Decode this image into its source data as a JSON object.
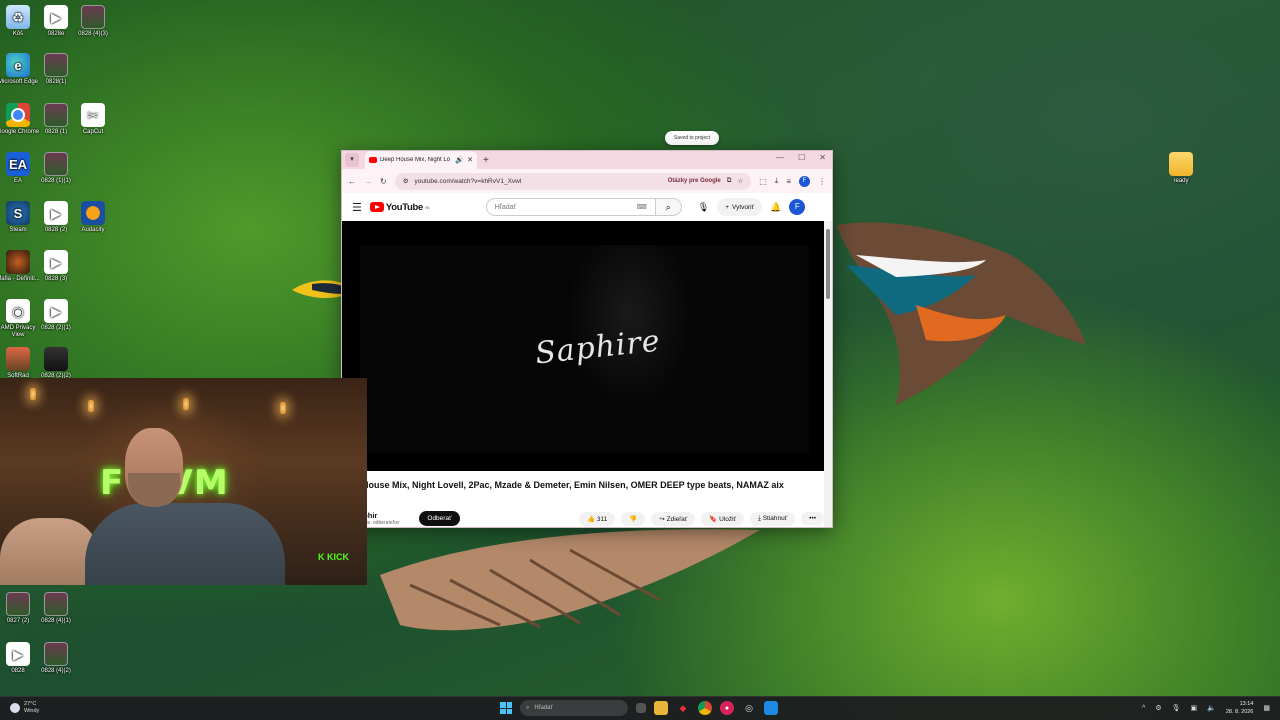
{
  "desktop": {
    "icons_left": [
      {
        "label": "Kôš",
        "glyph": "♻",
        "kind": "bin"
      },
      {
        "label": "0828e",
        "glyph": "▶",
        "kind": "play"
      },
      {
        "label": "0828 (4)(3)",
        "glyph": "",
        "kind": "thumb"
      },
      {
        "label": "Microsoft Edge",
        "glyph": "e",
        "kind": "edge"
      },
      {
        "label": "0828(1)",
        "glyph": "",
        "kind": "thumb"
      },
      {
        "label": "Google Chrome",
        "glyph": "",
        "kind": "chrome"
      },
      {
        "label": "0828 (1)",
        "glyph": "",
        "kind": "thumb"
      },
      {
        "label": "CapCut",
        "glyph": "✂",
        "kind": "capcut"
      },
      {
        "label": "EA",
        "glyph": "EA",
        "kind": "ea"
      },
      {
        "label": "0828 (1)(1)",
        "glyph": "",
        "kind": "thumb"
      },
      {
        "label": "Steam",
        "glyph": "S",
        "kind": "steam"
      },
      {
        "label": "0828 (2)",
        "glyph": "▶",
        "kind": "play"
      },
      {
        "label": "Audacity",
        "glyph": "",
        "kind": "aud"
      },
      {
        "label": "Mafia - Definiti...",
        "glyph": "",
        "kind": "mafia"
      },
      {
        "label": "0828 (3)",
        "glyph": "▶",
        "kind": "play"
      },
      {
        "label": "AMD Privacy View",
        "glyph": "◉",
        "kind": "amd"
      },
      {
        "label": "0828 (2)(1)",
        "glyph": "▶",
        "kind": "play"
      },
      {
        "label": "SoftRad",
        "glyph": "",
        "kind": "soft"
      },
      {
        "label": "0828 (2)(2)",
        "glyph": "",
        "kind": "dark"
      },
      {
        "label": "0827 (2)",
        "glyph": "",
        "kind": "thumb"
      },
      {
        "label": "0828 (4)(1)",
        "glyph": "",
        "kind": "thumb"
      },
      {
        "label": "0828",
        "glyph": "▶",
        "kind": "play"
      },
      {
        "label": "0828 (4)(2)",
        "glyph": "",
        "kind": "thumb"
      }
    ],
    "folder_right": {
      "label": "ready"
    }
  },
  "toast": "Saved to project",
  "browser": {
    "tab_title": "Deep House Mix, Night Lo",
    "url": "youtube.com/watch?v=khRvV1_Xvwl",
    "google_chip": "Otázky pre Google",
    "profile_letter": "F",
    "yt": {
      "logo_text": "YouTube",
      "region": "SK",
      "search_placeholder": "Hľadať",
      "create_label": "Vytvoriť",
      "avatar_letter": "F",
      "video_overlay_text": "Saphire",
      "video_title": "p House Mix, Night Lovell, 2Pac, Mzade & Demeter, Emin Nilsen, OMER DEEP type beats, NAMAZ aix",
      "channel_name": "Saphir",
      "channel_subs": "8,87 tis. odberateľov",
      "subscribe_label": "Odberať",
      "like_count": "311",
      "share_label": "Zdieľať",
      "save_label": "Uložiť",
      "download_label": "Stiahnuť",
      "more_label": "•••"
    }
  },
  "webcam": {
    "neon_text": "F NVM",
    "kick_text": "K KICK"
  },
  "taskbar": {
    "temp": "27°C",
    "weather": "Windy",
    "search_placeholder": "Hľadať",
    "time": "13:14",
    "date": "28. 8. 2026"
  }
}
